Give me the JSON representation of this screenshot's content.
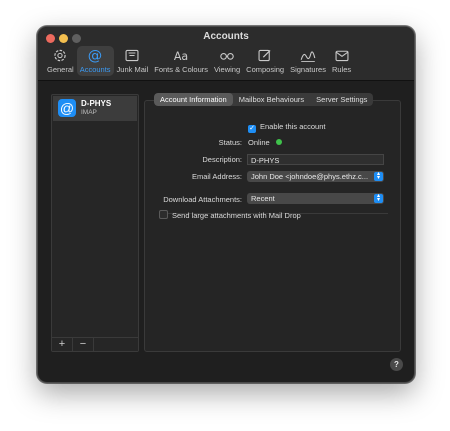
{
  "window": {
    "title": "Accounts"
  },
  "toolbar": {
    "items": [
      {
        "label": "General",
        "icon": "gear-icon"
      },
      {
        "label": "Accounts",
        "icon": "at-icon",
        "active": true
      },
      {
        "label": "Junk Mail",
        "icon": "junk-icon"
      },
      {
        "label": "Fonts & Colours",
        "icon": "font-icon"
      },
      {
        "label": "Viewing",
        "icon": "glasses-icon"
      },
      {
        "label": "Composing",
        "icon": "compose-icon"
      },
      {
        "label": "Signatures",
        "icon": "signature-icon"
      },
      {
        "label": "Rules",
        "icon": "rules-icon"
      }
    ]
  },
  "sidebar": {
    "account": {
      "name": "D-PHYS",
      "type": "IMAP",
      "icon_glyph": "@"
    },
    "add_label": "+",
    "remove_label": "−"
  },
  "tabs": [
    "Account Information",
    "Mailbox Behaviours",
    "Server Settings"
  ],
  "form": {
    "enable_label": "Enable this account",
    "status_label": "Status:",
    "status_value": "Online",
    "description_label": "Description:",
    "description_value": "D-PHYS",
    "email_label": "Email Address:",
    "email_value": "John Doe <johndoe@phys.ethz.c...",
    "download_label": "Download Attachments:",
    "download_value": "Recent",
    "large_attach_label": "Send large attachments with Mail Drop"
  },
  "help_label": "?",
  "colors": {
    "accent": "#1e8ef5",
    "online": "#3fc24b",
    "active_tab_text": "#3b9bf5"
  }
}
